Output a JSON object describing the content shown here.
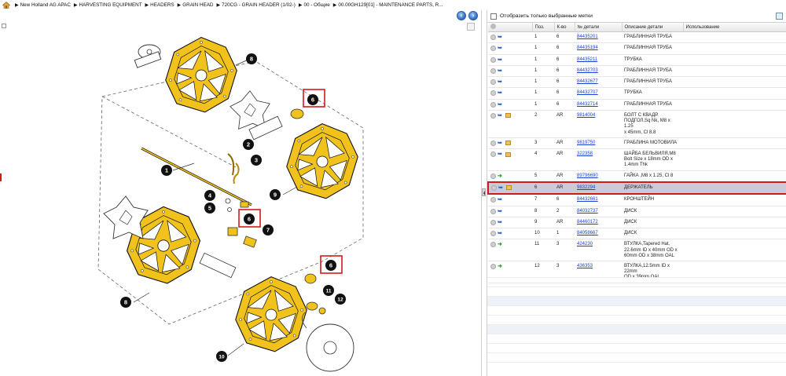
{
  "breadcrumb": {
    "items": [
      "New Holland AG APAC",
      "HARVESTING EQUIPMENT",
      "HEADERS",
      "GRAIN HEAD",
      "720CG - GRAIN HEADER (1/02-)",
      "00 - Общие",
      "00.00GH129[01] - MAINTENANCE PARTS, R..."
    ],
    "separator": "▶"
  },
  "diagram": {
    "callouts": [
      "8",
      "6",
      "2",
      "3",
      "1",
      "9",
      "4",
      "5",
      "6",
      "7",
      "8",
      "6",
      "11",
      "12",
      "10"
    ],
    "accent_color": "#f2c21c",
    "highlight_color": "#d11b1b"
  },
  "parts_panel": {
    "filter_label": "Отобразить только выбранные метки",
    "columns": {
      "pos": "Поз.",
      "qty": "К-во",
      "part_no": "№ детали",
      "desc": "Описание детали",
      "usage": "Использование"
    },
    "rows": [
      {
        "pos": "1",
        "qty": "6",
        "part_no": "84435201",
        "desc": [
          "ГРАБЛИННАЯ ТРУБА"
        ],
        "arrow": "blue",
        "box": false
      },
      {
        "pos": "1",
        "qty": "6",
        "part_no": "84435194",
        "desc": [
          "ГРАБЛИННАЯ ТРУБА"
        ],
        "arrow": "blue",
        "box": false
      },
      {
        "pos": "1",
        "qty": "6",
        "part_no": "84435211",
        "desc": [
          "ТРУБКА"
        ],
        "arrow": "blue",
        "box": false
      },
      {
        "pos": "1",
        "qty": "6",
        "part_no": "84432703",
        "desc": [
          "ГРАБЛИННАЯ ТРУБА"
        ],
        "arrow": "blue",
        "box": false
      },
      {
        "pos": "1",
        "qty": "6",
        "part_no": "84432677",
        "desc": [
          "ГРАБЛИННАЯ ТРУБА"
        ],
        "arrow": "blue",
        "box": false
      },
      {
        "pos": "1",
        "qty": "6",
        "part_no": "84432707",
        "desc": [
          "ТРУБКА"
        ],
        "arrow": "blue",
        "box": false
      },
      {
        "pos": "1",
        "qty": "6",
        "part_no": "84432714",
        "desc": [
          "ГРАБЛИННАЯ ТРУБА"
        ],
        "arrow": "blue",
        "box": false
      },
      {
        "pos": "2",
        "qty": "AR",
        "part_no": "9814004",
        "desc": [
          "БОЛТ С КВАДР.",
          "ПОДГОЛ.Sq Nk, M8 x 1.25",
          "x 45mm, Cl 8.8"
        ],
        "arrow": "blue",
        "box": true
      },
      {
        "pos": "3",
        "qty": "AR",
        "part_no": "9819750",
        "desc": [
          "ГРАБЛИНА МОТОВИЛА"
        ],
        "arrow": "blue",
        "box": true
      },
      {
        "pos": "4",
        "qty": "AR",
        "part_no": "322358",
        "desc": [
          "ШАЙБА БЕЛЬВИЛЯ,M8",
          "Bolt Size x 18mm OD x",
          "1.4mm Thk"
        ],
        "arrow": "blue",
        "box": true
      },
      {
        "pos": "5",
        "qty": "AR",
        "part_no": "89796690",
        "desc": [
          "ГАЙКА ,M8 x 1.25, Cl 8"
        ],
        "arrow": "green",
        "box": false
      },
      {
        "pos": "6",
        "qty": "AR",
        "part_no": "9832294",
        "desc": [
          "ДЕРЖАТЕЛЬ"
        ],
        "arrow": "blue",
        "box": true,
        "selected": true
      },
      {
        "pos": "7",
        "qty": "6",
        "part_no": "84432661",
        "desc": [
          "КРОНШТЕЙН"
        ],
        "arrow": "blue",
        "box": false
      },
      {
        "pos": "8",
        "qty": "2",
        "part_no": "84032737",
        "desc": [
          "ДИСК"
        ],
        "arrow": "blue",
        "box": false
      },
      {
        "pos": "9",
        "qty": "AR",
        "part_no": "84460172",
        "desc": [
          "ДИСК"
        ],
        "arrow": "blue",
        "box": false
      },
      {
        "pos": "10",
        "qty": "1",
        "part_no": "84058667",
        "desc": [
          "ДИСК"
        ],
        "arrow": "blue",
        "box": false
      },
      {
        "pos": "11",
        "qty": "3",
        "part_no": "424230",
        "desc": [
          "ВТУЛКА,Tapered Hat,",
          "22.6mm ID x 40mm OD x",
          "60mm OD x 38mm OAL"
        ],
        "arrow": "green",
        "box": false
      },
      {
        "pos": "12",
        "qty": "3",
        "part_no": "436353",
        "desc": [
          "ВТУЛКА,12.5mm ID x 22mm",
          "OD x 39mm OAL"
        ],
        "arrow": "green",
        "box": false
      }
    ]
  }
}
